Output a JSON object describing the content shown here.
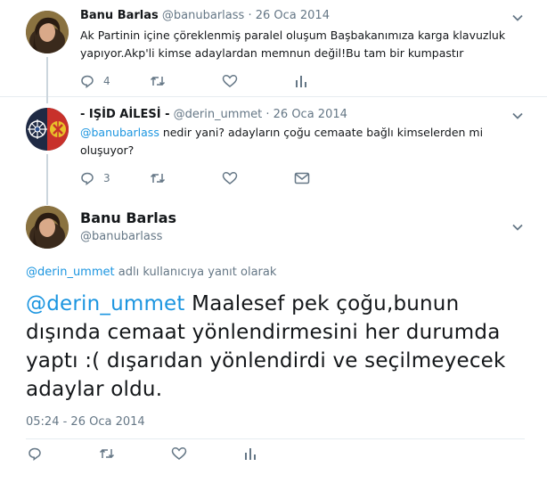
{
  "tweet1": {
    "name": "Banu Barlas",
    "handle": "@banubarlass",
    "dot": "·",
    "date": "26 Oca 2014",
    "text": "Ak Partinin içine çöreklenmiş paralel oluşum Başbakanımıza karga klavuzluk yapıyor.Akp'li kimse adaylardan memnun değil!Bu tam bir kumpastır",
    "reply_count": "4",
    "icons": [
      "reply-icon",
      "retweet-icon",
      "like-icon",
      "analytics-icon",
      "chevron-down-icon"
    ]
  },
  "tweet2": {
    "name": "- IŞİD AİLESİ -",
    "handle": "@derin_ummet",
    "dot": "·",
    "date": "26 Oca 2014",
    "mention": "@banubarlass",
    "text": " nedir yani? adayların çoğu cemaate bağlı kimselerden mi oluşuyor?",
    "reply_count": "3",
    "icons": [
      "reply-icon",
      "retweet-icon",
      "like-icon",
      "message-icon",
      "chevron-down-icon"
    ]
  },
  "main": {
    "name": "Banu Barlas",
    "handle": "@banubarlass",
    "reply_mention": "@derin_ummet",
    "reply_suffix": " adlı kullanıcıya yanıt olarak",
    "mention": "@derin_ummet",
    "text": " Maalesef pek çoğu,bunun dışında cemaat yönlendirmesini her durumda yaptı :( dışarıdan yönlendirdi ve seçilmeyecek adaylar oldu.",
    "timestamp": "05:24 - 26 Oca 2014",
    "icons": [
      "reply-icon",
      "retweet-icon",
      "like-icon",
      "analytics-icon",
      "chevron-down-icon"
    ]
  },
  "colors": {
    "link": "#1b95e0",
    "muted": "#657786",
    "thread_line": "#ccd6dd",
    "divider": "#e6ecf0"
  }
}
